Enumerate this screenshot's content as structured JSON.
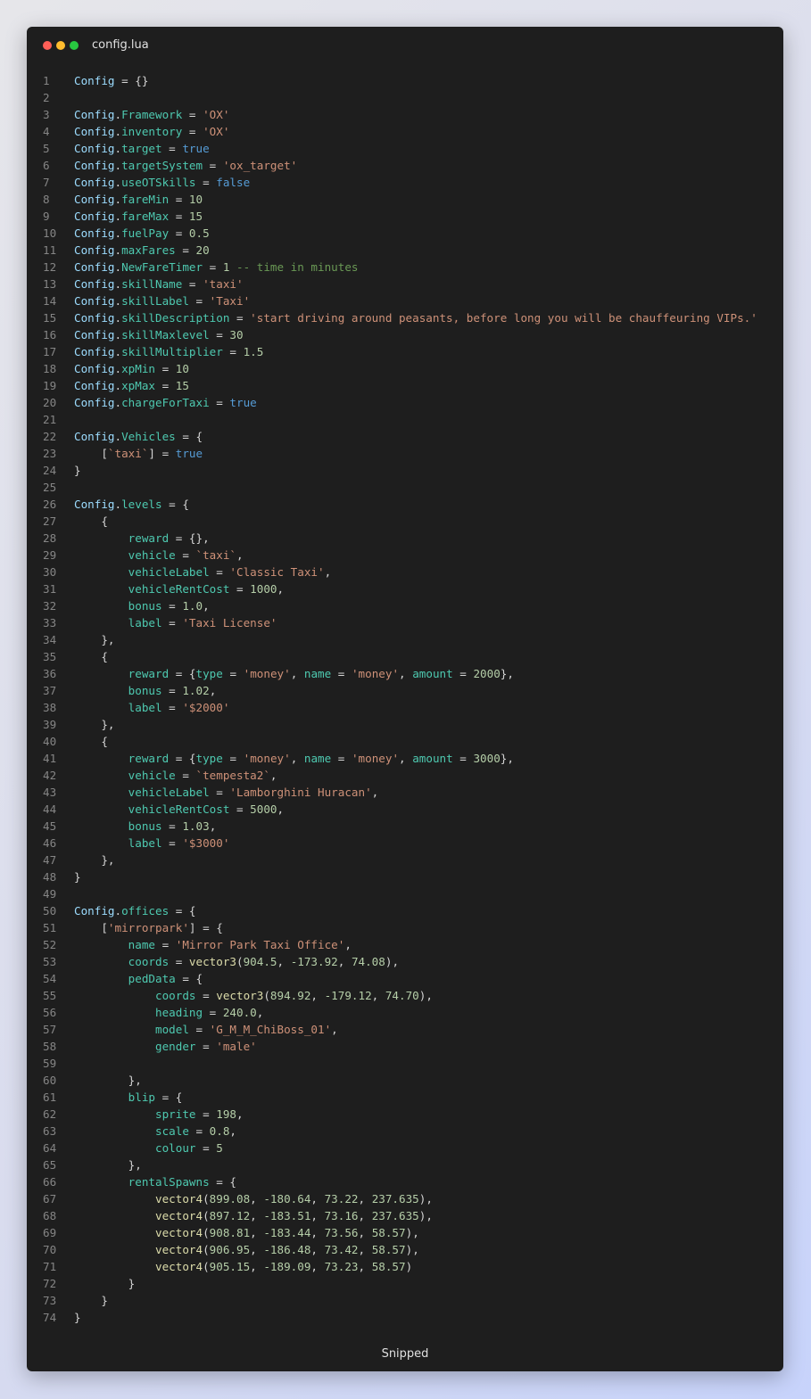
{
  "window": {
    "title": "config.lua",
    "footer": "Snipped",
    "controls": [
      "close",
      "minimize",
      "maximize"
    ]
  },
  "theme": {
    "background": "#1e1e1e",
    "close": "#ff5f57",
    "minimize": "#febc2e",
    "maximize": "#28c840",
    "identifier": "#9cdcfe",
    "property": "#4ec9b0",
    "string": "#ce9178",
    "number": "#b5cea8",
    "keyword": "#569cd6",
    "comment": "#6a9955",
    "function": "#dcdcaa"
  },
  "editor": {
    "language": "lua",
    "lines": [
      [
        [
          "k",
          "Config"
        ],
        [
          "p",
          " = {}"
        ]
      ],
      [],
      [
        [
          "k",
          "Config"
        ],
        [
          "p",
          "."
        ],
        [
          "a",
          "Framework"
        ],
        [
          "p",
          " = "
        ],
        [
          "s",
          "'OX'"
        ]
      ],
      [
        [
          "k",
          "Config"
        ],
        [
          "p",
          "."
        ],
        [
          "a",
          "inventory"
        ],
        [
          "p",
          " = "
        ],
        [
          "s",
          "'OX'"
        ]
      ],
      [
        [
          "k",
          "Config"
        ],
        [
          "p",
          "."
        ],
        [
          "a",
          "target"
        ],
        [
          "p",
          " = "
        ],
        [
          "b",
          "true"
        ]
      ],
      [
        [
          "k",
          "Config"
        ],
        [
          "p",
          "."
        ],
        [
          "a",
          "targetSystem"
        ],
        [
          "p",
          " = "
        ],
        [
          "s",
          "'ox_target'"
        ]
      ],
      [
        [
          "k",
          "Config"
        ],
        [
          "p",
          "."
        ],
        [
          "a",
          "useOTSkills"
        ],
        [
          "p",
          " = "
        ],
        [
          "b",
          "false"
        ]
      ],
      [
        [
          "k",
          "Config"
        ],
        [
          "p",
          "."
        ],
        [
          "a",
          "fareMin"
        ],
        [
          "p",
          " = "
        ],
        [
          "n",
          "10"
        ]
      ],
      [
        [
          "k",
          "Config"
        ],
        [
          "p",
          "."
        ],
        [
          "a",
          "fareMax"
        ],
        [
          "p",
          " = "
        ],
        [
          "n",
          "15"
        ]
      ],
      [
        [
          "k",
          "Config"
        ],
        [
          "p",
          "."
        ],
        [
          "a",
          "fuelPay"
        ],
        [
          "p",
          " = "
        ],
        [
          "n",
          "0.5"
        ]
      ],
      [
        [
          "k",
          "Config"
        ],
        [
          "p",
          "."
        ],
        [
          "a",
          "maxFares"
        ],
        [
          "p",
          " = "
        ],
        [
          "n",
          "20"
        ]
      ],
      [
        [
          "k",
          "Config"
        ],
        [
          "p",
          "."
        ],
        [
          "a",
          "NewFareTimer"
        ],
        [
          "p",
          " = "
        ],
        [
          "n",
          "1"
        ],
        [
          "c",
          " -- time in minutes"
        ]
      ],
      [
        [
          "k",
          "Config"
        ],
        [
          "p",
          "."
        ],
        [
          "a",
          "skillName"
        ],
        [
          "p",
          " = "
        ],
        [
          "s",
          "'taxi'"
        ]
      ],
      [
        [
          "k",
          "Config"
        ],
        [
          "p",
          "."
        ],
        [
          "a",
          "skillLabel"
        ],
        [
          "p",
          " = "
        ],
        [
          "s",
          "'Taxi'"
        ]
      ],
      [
        [
          "k",
          "Config"
        ],
        [
          "p",
          "."
        ],
        [
          "a",
          "skillDescription"
        ],
        [
          "p",
          " = "
        ],
        [
          "s",
          "'start driving around peasants, before long you will be chauffeuring VIPs.'"
        ]
      ],
      [
        [
          "k",
          "Config"
        ],
        [
          "p",
          "."
        ],
        [
          "a",
          "skillMaxlevel"
        ],
        [
          "p",
          " = "
        ],
        [
          "n",
          "30"
        ]
      ],
      [
        [
          "k",
          "Config"
        ],
        [
          "p",
          "."
        ],
        [
          "a",
          "skillMultiplier"
        ],
        [
          "p",
          " = "
        ],
        [
          "n",
          "1.5"
        ]
      ],
      [
        [
          "k",
          "Config"
        ],
        [
          "p",
          "."
        ],
        [
          "a",
          "xpMin"
        ],
        [
          "p",
          " = "
        ],
        [
          "n",
          "10"
        ]
      ],
      [
        [
          "k",
          "Config"
        ],
        [
          "p",
          "."
        ],
        [
          "a",
          "xpMax"
        ],
        [
          "p",
          " = "
        ],
        [
          "n",
          "15"
        ]
      ],
      [
        [
          "k",
          "Config"
        ],
        [
          "p",
          "."
        ],
        [
          "a",
          "chargeForTaxi"
        ],
        [
          "p",
          " = "
        ],
        [
          "b",
          "true"
        ]
      ],
      [],
      [
        [
          "k",
          "Config"
        ],
        [
          "p",
          "."
        ],
        [
          "a",
          "Vehicles"
        ],
        [
          "p",
          " = {"
        ]
      ],
      [
        [
          "p",
          "    ["
        ],
        [
          "s",
          "`taxi`"
        ],
        [
          "p",
          "] = "
        ],
        [
          "b",
          "true"
        ]
      ],
      [
        [
          "p",
          "}"
        ]
      ],
      [],
      [
        [
          "k",
          "Config"
        ],
        [
          "p",
          "."
        ],
        [
          "a",
          "levels"
        ],
        [
          "p",
          " = {"
        ]
      ],
      [
        [
          "p",
          "    {"
        ]
      ],
      [
        [
          "p",
          "        "
        ],
        [
          "a",
          "reward"
        ],
        [
          "p",
          " = {},"
        ]
      ],
      [
        [
          "p",
          "        "
        ],
        [
          "a",
          "vehicle"
        ],
        [
          "p",
          " = "
        ],
        [
          "s",
          "`taxi`"
        ],
        [
          "p",
          ","
        ]
      ],
      [
        [
          "p",
          "        "
        ],
        [
          "a",
          "vehicleLabel"
        ],
        [
          "p",
          " = "
        ],
        [
          "s",
          "'Classic Taxi'"
        ],
        [
          "p",
          ","
        ]
      ],
      [
        [
          "p",
          "        "
        ],
        [
          "a",
          "vehicleRentCost"
        ],
        [
          "p",
          " = "
        ],
        [
          "n",
          "1000"
        ],
        [
          "p",
          ","
        ]
      ],
      [
        [
          "p",
          "        "
        ],
        [
          "a",
          "bonus"
        ],
        [
          "p",
          " = "
        ],
        [
          "n",
          "1.0"
        ],
        [
          "p",
          ","
        ]
      ],
      [
        [
          "p",
          "        "
        ],
        [
          "a",
          "label"
        ],
        [
          "p",
          " = "
        ],
        [
          "s",
          "'Taxi License'"
        ]
      ],
      [
        [
          "p",
          "    },"
        ]
      ],
      [
        [
          "p",
          "    {"
        ]
      ],
      [
        [
          "p",
          "        "
        ],
        [
          "a",
          "reward"
        ],
        [
          "p",
          " = {"
        ],
        [
          "a",
          "type"
        ],
        [
          "p",
          " = "
        ],
        [
          "s",
          "'money'"
        ],
        [
          "p",
          ", "
        ],
        [
          "a",
          "name"
        ],
        [
          "p",
          " = "
        ],
        [
          "s",
          "'money'"
        ],
        [
          "p",
          ", "
        ],
        [
          "a",
          "amount"
        ],
        [
          "p",
          " = "
        ],
        [
          "n",
          "2000"
        ],
        [
          "p",
          "},"
        ]
      ],
      [
        [
          "p",
          "        "
        ],
        [
          "a",
          "bonus"
        ],
        [
          "p",
          " = "
        ],
        [
          "n",
          "1.02"
        ],
        [
          "p",
          ","
        ]
      ],
      [
        [
          "p",
          "        "
        ],
        [
          "a",
          "label"
        ],
        [
          "p",
          " = "
        ],
        [
          "s",
          "'$2000'"
        ]
      ],
      [
        [
          "p",
          "    },"
        ]
      ],
      [
        [
          "p",
          "    {"
        ]
      ],
      [
        [
          "p",
          "        "
        ],
        [
          "a",
          "reward"
        ],
        [
          "p",
          " = {"
        ],
        [
          "a",
          "type"
        ],
        [
          "p",
          " = "
        ],
        [
          "s",
          "'money'"
        ],
        [
          "p",
          ", "
        ],
        [
          "a",
          "name"
        ],
        [
          "p",
          " = "
        ],
        [
          "s",
          "'money'"
        ],
        [
          "p",
          ", "
        ],
        [
          "a",
          "amount"
        ],
        [
          "p",
          " = "
        ],
        [
          "n",
          "3000"
        ],
        [
          "p",
          "},"
        ]
      ],
      [
        [
          "p",
          "        "
        ],
        [
          "a",
          "vehicle"
        ],
        [
          "p",
          " = "
        ],
        [
          "s",
          "`tempesta2`"
        ],
        [
          "p",
          ","
        ]
      ],
      [
        [
          "p",
          "        "
        ],
        [
          "a",
          "vehicleLabel"
        ],
        [
          "p",
          " = "
        ],
        [
          "s",
          "'Lamborghini Huracan'"
        ],
        [
          "p",
          ","
        ]
      ],
      [
        [
          "p",
          "        "
        ],
        [
          "a",
          "vehicleRentCost"
        ],
        [
          "p",
          " = "
        ],
        [
          "n",
          "5000"
        ],
        [
          "p",
          ","
        ]
      ],
      [
        [
          "p",
          "        "
        ],
        [
          "a",
          "bonus"
        ],
        [
          "p",
          " = "
        ],
        [
          "n",
          "1.03"
        ],
        [
          "p",
          ","
        ]
      ],
      [
        [
          "p",
          "        "
        ],
        [
          "a",
          "label"
        ],
        [
          "p",
          " = "
        ],
        [
          "s",
          "'$3000'"
        ]
      ],
      [
        [
          "p",
          "    },"
        ]
      ],
      [
        [
          "p",
          "}"
        ]
      ],
      [],
      [
        [
          "k",
          "Config"
        ],
        [
          "p",
          "."
        ],
        [
          "a",
          "offices"
        ],
        [
          "p",
          " = {"
        ]
      ],
      [
        [
          "p",
          "    ["
        ],
        [
          "s",
          "'mirrorpark'"
        ],
        [
          "p",
          "] = {"
        ]
      ],
      [
        [
          "p",
          "        "
        ],
        [
          "a",
          "name"
        ],
        [
          "p",
          " = "
        ],
        [
          "s",
          "'Mirror Park Taxi Office'"
        ],
        [
          "p",
          ","
        ]
      ],
      [
        [
          "p",
          "        "
        ],
        [
          "a",
          "coords"
        ],
        [
          "p",
          " = "
        ],
        [
          "f",
          "vector3"
        ],
        [
          "p",
          "("
        ],
        [
          "n",
          "904.5"
        ],
        [
          "p",
          ", "
        ],
        [
          "n",
          "-173.92"
        ],
        [
          "p",
          ", "
        ],
        [
          "n",
          "74.08"
        ],
        [
          "p",
          "),"
        ]
      ],
      [
        [
          "p",
          "        "
        ],
        [
          "a",
          "pedData"
        ],
        [
          "p",
          " = {"
        ]
      ],
      [
        [
          "p",
          "            "
        ],
        [
          "a",
          "coords"
        ],
        [
          "p",
          " = "
        ],
        [
          "f",
          "vector3"
        ],
        [
          "p",
          "("
        ],
        [
          "n",
          "894.92"
        ],
        [
          "p",
          ", "
        ],
        [
          "n",
          "-179.12"
        ],
        [
          "p",
          ", "
        ],
        [
          "n",
          "74.70"
        ],
        [
          "p",
          "),"
        ]
      ],
      [
        [
          "p",
          "            "
        ],
        [
          "a",
          "heading"
        ],
        [
          "p",
          " = "
        ],
        [
          "n",
          "240.0"
        ],
        [
          "p",
          ","
        ]
      ],
      [
        [
          "p",
          "            "
        ],
        [
          "a",
          "model"
        ],
        [
          "p",
          " = "
        ],
        [
          "s",
          "'G_M_M_ChiBoss_01'"
        ],
        [
          "p",
          ","
        ]
      ],
      [
        [
          "p",
          "            "
        ],
        [
          "a",
          "gender"
        ],
        [
          "p",
          " = "
        ],
        [
          "s",
          "'male'"
        ]
      ],
      [],
      [
        [
          "p",
          "        },"
        ]
      ],
      [
        [
          "p",
          "        "
        ],
        [
          "a",
          "blip"
        ],
        [
          "p",
          " = {"
        ]
      ],
      [
        [
          "p",
          "            "
        ],
        [
          "a",
          "sprite"
        ],
        [
          "p",
          " = "
        ],
        [
          "n",
          "198"
        ],
        [
          "p",
          ","
        ]
      ],
      [
        [
          "p",
          "            "
        ],
        [
          "a",
          "scale"
        ],
        [
          "p",
          " = "
        ],
        [
          "n",
          "0.8"
        ],
        [
          "p",
          ","
        ]
      ],
      [
        [
          "p",
          "            "
        ],
        [
          "a",
          "colour"
        ],
        [
          "p",
          " = "
        ],
        [
          "n",
          "5"
        ]
      ],
      [
        [
          "p",
          "        },"
        ]
      ],
      [
        [
          "p",
          "        "
        ],
        [
          "a",
          "rentalSpawns"
        ],
        [
          "p",
          " = {"
        ]
      ],
      [
        [
          "p",
          "            "
        ],
        [
          "f",
          "vector4"
        ],
        [
          "p",
          "("
        ],
        [
          "n",
          "899.08"
        ],
        [
          "p",
          ", "
        ],
        [
          "n",
          "-180.64"
        ],
        [
          "p",
          ", "
        ],
        [
          "n",
          "73.22"
        ],
        [
          "p",
          ", "
        ],
        [
          "n",
          "237.635"
        ],
        [
          "p",
          "),"
        ]
      ],
      [
        [
          "p",
          "            "
        ],
        [
          "f",
          "vector4"
        ],
        [
          "p",
          "("
        ],
        [
          "n",
          "897.12"
        ],
        [
          "p",
          ", "
        ],
        [
          "n",
          "-183.51"
        ],
        [
          "p",
          ", "
        ],
        [
          "n",
          "73.16"
        ],
        [
          "p",
          ", "
        ],
        [
          "n",
          "237.635"
        ],
        [
          "p",
          "),"
        ]
      ],
      [
        [
          "p",
          "            "
        ],
        [
          "f",
          "vector4"
        ],
        [
          "p",
          "("
        ],
        [
          "n",
          "908.81"
        ],
        [
          "p",
          ", "
        ],
        [
          "n",
          "-183.44"
        ],
        [
          "p",
          ", "
        ],
        [
          "n",
          "73.56"
        ],
        [
          "p",
          ", "
        ],
        [
          "n",
          "58.57"
        ],
        [
          "p",
          "),"
        ]
      ],
      [
        [
          "p",
          "            "
        ],
        [
          "f",
          "vector4"
        ],
        [
          "p",
          "("
        ],
        [
          "n",
          "906.95"
        ],
        [
          "p",
          ", "
        ],
        [
          "n",
          "-186.48"
        ],
        [
          "p",
          ", "
        ],
        [
          "n",
          "73.42"
        ],
        [
          "p",
          ", "
        ],
        [
          "n",
          "58.57"
        ],
        [
          "p",
          "),"
        ]
      ],
      [
        [
          "p",
          "            "
        ],
        [
          "f",
          "vector4"
        ],
        [
          "p",
          "("
        ],
        [
          "n",
          "905.15"
        ],
        [
          "p",
          ", "
        ],
        [
          "n",
          "-189.09"
        ],
        [
          "p",
          ", "
        ],
        [
          "n",
          "73.23"
        ],
        [
          "p",
          ", "
        ],
        [
          "n",
          "58.57"
        ],
        [
          "p",
          ")"
        ]
      ],
      [
        [
          "p",
          "        }"
        ]
      ],
      [
        [
          "p",
          "    }"
        ]
      ],
      [
        [
          "p",
          "}"
        ]
      ]
    ]
  }
}
